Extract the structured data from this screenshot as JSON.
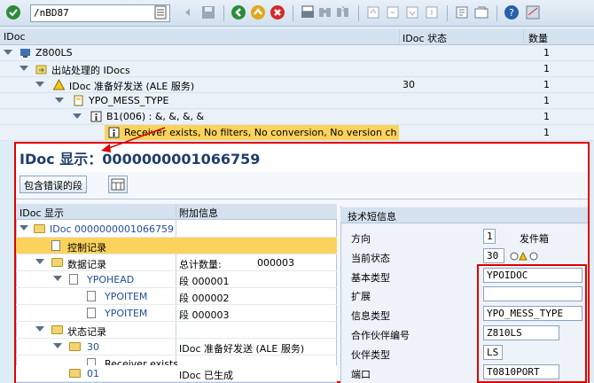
{
  "toolbar": {
    "command": "/nBD87"
  },
  "upper": {
    "headers": {
      "idoc": "IDoc",
      "status": "IDoc 状态",
      "count": "数量"
    },
    "rows": [
      {
        "label": "Z800LS",
        "status": "",
        "count": "1"
      },
      {
        "label": "出站处理的 IDocs",
        "status": "",
        "count": "1"
      },
      {
        "label": "IDoc 准备好发送 (ALE 服务)",
        "status": "30",
        "count": "1"
      },
      {
        "label": "YPO_MESS_TYPE",
        "status": "",
        "count": "1"
      },
      {
        "label": "B1(006) : &, &, &, &",
        "status": "",
        "count": "1"
      },
      {
        "label": "Receiver exists, No filters, No conversion, No version cha",
        "status": "",
        "count": "1"
      }
    ]
  },
  "panel": {
    "title_prefix": "IDoc 显示：",
    "title_number": "0000000001066759",
    "error_button": "包含错误的段",
    "left_headers": {
      "c1": "IDoc 显示",
      "c2": "附加信息"
    },
    "tree": [
      {
        "label": "IDoc 0000000001066759",
        "info": "",
        "val": ""
      },
      {
        "label": "控制记录",
        "info": "",
        "val": ""
      },
      {
        "label": "数据记录",
        "info": "总计数量:",
        "val": "000003"
      },
      {
        "label": "YPOHEAD",
        "info": "段 000001",
        "val": ""
      },
      {
        "label": "YPOITEM",
        "info": "段 000002",
        "val": ""
      },
      {
        "label": "YPOITEM",
        "info": "段 000003",
        "val": ""
      },
      {
        "label": "状态记录",
        "info": "",
        "val": ""
      },
      {
        "label": "30",
        "info": "IDoc 准备好发送 (ALE 服务)",
        "val": ""
      },
      {
        "label": "Receiver exists",
        "info": "",
        "val": ""
      },
      {
        "label": "01",
        "info": "IDoc 已生成",
        "val": ""
      }
    ],
    "tech": {
      "header": "技术短信息",
      "direction_label": "方向",
      "direction_value": "1",
      "direction_text": "发件箱",
      "status_label": "当前状态",
      "status_value": "30",
      "basic_type_label": "基本类型",
      "basic_type_value": "YPOIDOC",
      "extension_label": "扩展",
      "extension_value": "",
      "message_type_label": "信息类型",
      "message_type_value": "YPO_MESS_TYPE",
      "partner_no_label": "合作伙伴编号",
      "partner_no_value": "Z810LS",
      "partner_type_label": "伙伴类型",
      "partner_type_value": "LS",
      "port_label": "端口",
      "port_value": "T0810PORT"
    }
  },
  "colors": {
    "highlight": "#fbd35c",
    "annotation": "#e00000",
    "link": "#1f4e9c"
  }
}
